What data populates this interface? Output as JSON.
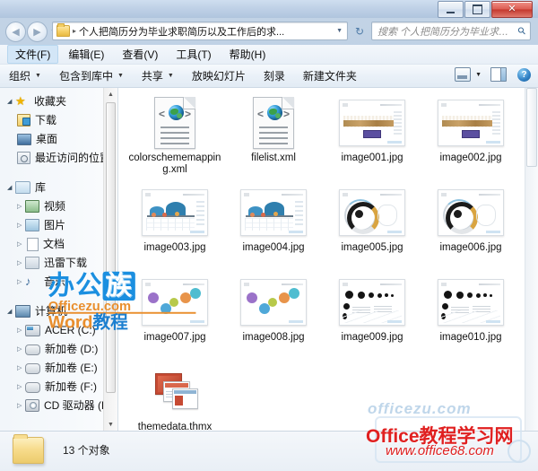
{
  "window": {
    "minimize_label": "",
    "maximize_label": "",
    "close_label": "✕"
  },
  "address_bar": {
    "back_glyph": "◀",
    "forward_glyph": "▶",
    "history_caret": "▼",
    "folder_icon": "folder-icon",
    "separator": "▸",
    "path_text": "个人把简历分为毕业求职简历以及工作后的求...",
    "dropdown_caret": "▼",
    "refresh_glyph": "↻"
  },
  "search": {
    "placeholder": "搜索 个人把简历分为毕业求职简历以...",
    "icon": "search-icon"
  },
  "menu": {
    "items": [
      {
        "label": "文件(F)"
      },
      {
        "label": "编辑(E)"
      },
      {
        "label": "查看(V)"
      },
      {
        "label": "工具(T)"
      },
      {
        "label": "帮助(H)"
      }
    ]
  },
  "toolbar": {
    "items": [
      {
        "label": "组织",
        "caret": "▼"
      },
      {
        "label": "包含到库中",
        "caret": "▼"
      },
      {
        "label": "共享",
        "caret": "▼"
      },
      {
        "label": "放映幻灯片",
        "caret": ""
      },
      {
        "label": "刻录",
        "caret": ""
      },
      {
        "label": "新建文件夹",
        "caret": ""
      }
    ],
    "view_caret": "▼",
    "help_label": "?"
  },
  "sidebar": {
    "scroll_up": "▲",
    "scroll_down": "▼",
    "groups": [
      {
        "name": "favorites",
        "header": {
          "label": "收藏夹",
          "tri": "◢",
          "icon": "star-icon"
        },
        "items": [
          {
            "label": "下载",
            "icon": "downloads-icon",
            "tri": ""
          },
          {
            "label": "桌面",
            "icon": "desktop-icon",
            "tri": ""
          },
          {
            "label": "最近访问的位置",
            "icon": "recent-places-icon",
            "tri": ""
          }
        ]
      },
      {
        "name": "libraries",
        "header": {
          "label": "库",
          "tri": "◢",
          "icon": "library-icon"
        },
        "items": [
          {
            "label": "视频",
            "icon": "video-icon",
            "tri": "▷"
          },
          {
            "label": "图片",
            "icon": "pictures-icon",
            "tri": "▷"
          },
          {
            "label": "文档",
            "icon": "documents-icon",
            "tri": "▷"
          },
          {
            "label": "迅雷下载",
            "icon": "thunder-download-icon",
            "tri": "▷"
          },
          {
            "label": "音乐",
            "icon": "music-icon",
            "tri": "▷"
          }
        ]
      },
      {
        "name": "computer",
        "header": {
          "label": "计算机",
          "tri": "◢",
          "icon": "computer-icon"
        },
        "items": [
          {
            "label": "ACER (C:)",
            "icon": "system-drive-icon",
            "tri": "▷"
          },
          {
            "label": "新加卷 (D:)",
            "icon": "drive-icon",
            "tri": "▷"
          },
          {
            "label": "新加卷 (E:)",
            "icon": "drive-icon",
            "tri": "▷"
          },
          {
            "label": "新加卷 (F:)",
            "icon": "drive-icon",
            "tri": "▷"
          },
          {
            "label": "CD 驱动器 (H:) (",
            "icon": "cd-drive-icon",
            "tri": "▷"
          }
        ]
      }
    ]
  },
  "files": [
    {
      "name": "colorschememapping.xml",
      "kind": "xml"
    },
    {
      "name": "filelist.xml",
      "kind": "xml"
    },
    {
      "name": "image001.jpg",
      "kind": "jpg-wave"
    },
    {
      "name": "image002.jpg",
      "kind": "jpg-wave"
    },
    {
      "name": "image003.jpg",
      "kind": "jpg-dome"
    },
    {
      "name": "image004.jpg",
      "kind": "jpg-dome"
    },
    {
      "name": "image005.jpg",
      "kind": "jpg-ring"
    },
    {
      "name": "image006.jpg",
      "kind": "jpg-ring"
    },
    {
      "name": "image007.jpg",
      "kind": "jpg-bubble"
    },
    {
      "name": "image008.jpg",
      "kind": "jpg-bubble"
    },
    {
      "name": "image009.jpg",
      "kind": "jpg-dots"
    },
    {
      "name": "image010.jpg",
      "kind": "jpg-dots"
    },
    {
      "name": "themedata.thmx",
      "kind": "thmx"
    }
  ],
  "status": {
    "icon": "folder-icon",
    "text": "13 个对象"
  },
  "watermarks": {
    "left": {
      "line1_a": "办公",
      "line1_b": "族",
      "line2": "Officezu.com",
      "line3_o": "Word",
      "line3_rest": "教程"
    },
    "right": {
      "blue": "officezu.com",
      "red_main": "Office教程学习网",
      "red_sub": "www.office68.com"
    }
  },
  "colors": {
    "accent": "#1b8fe0",
    "watermark_red": "#e02020",
    "watermark_orange": "#e98f2e",
    "close_button": "#c4382e",
    "folder_yellow": "#f5cf64"
  }
}
